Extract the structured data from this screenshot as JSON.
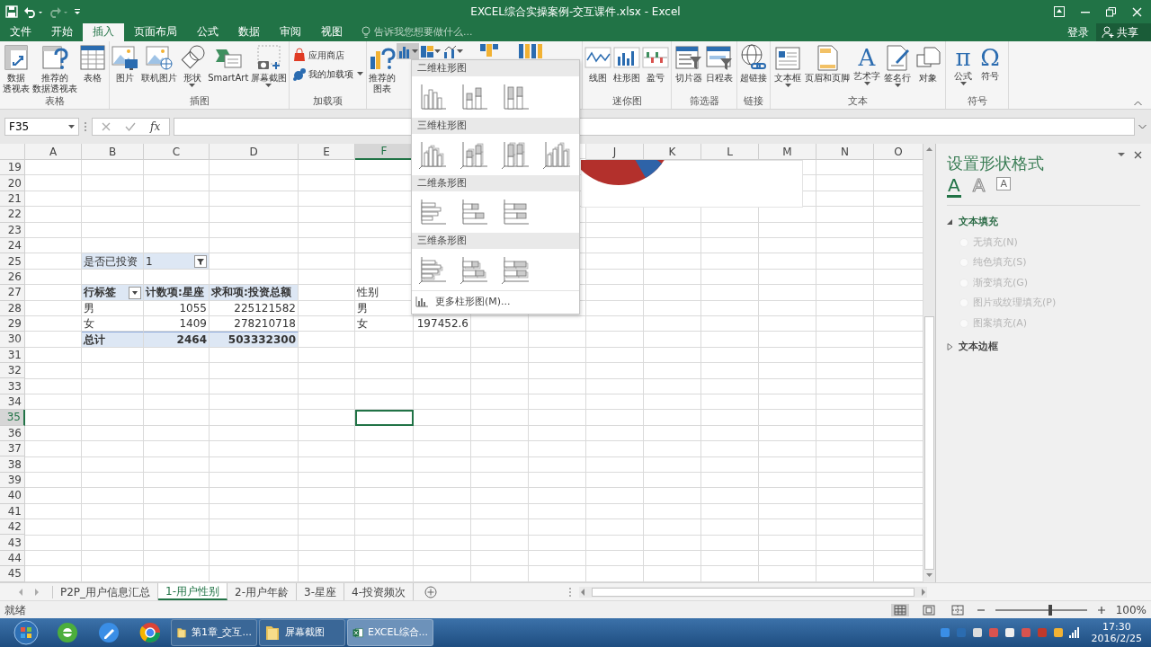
{
  "window": {
    "title": "EXCEL综合实操案例-交互课件.xlsx - Excel"
  },
  "ribbon_tabs": [
    {
      "label": "文件",
      "selected": false
    },
    {
      "label": "开始",
      "selected": false
    },
    {
      "label": "插入",
      "selected": true
    },
    {
      "label": "页面布局",
      "selected": false
    },
    {
      "label": "公式",
      "selected": false
    },
    {
      "label": "数据",
      "selected": false
    },
    {
      "label": "审阅",
      "selected": false
    },
    {
      "label": "视图",
      "selected": false
    }
  ],
  "tell_me": {
    "placeholder": "告诉我您想要做什么..."
  },
  "account": {
    "sign_in": "登录",
    "share": "共享"
  },
  "ribbon_groups": [
    {
      "label": "表格",
      "buttons": [
        {
          "kind": "large",
          "label": [
            "数据",
            "透视表"
          ]
        },
        {
          "kind": "large",
          "label": [
            "推荐的",
            "数据透视表"
          ]
        },
        {
          "kind": "large",
          "label": [
            "表格"
          ]
        }
      ]
    },
    {
      "label": "插图",
      "buttons": [
        {
          "kind": "large",
          "label": [
            "图片"
          ]
        },
        {
          "kind": "large",
          "label": [
            "联机图片"
          ]
        },
        {
          "kind": "large",
          "label": [
            "形状"
          ],
          "dropdown": true
        },
        {
          "kind": "large",
          "label": [
            "SmartArt"
          ]
        },
        {
          "kind": "large",
          "label": [
            "屏幕截图"
          ],
          "dropdown": true
        }
      ]
    },
    {
      "label": "加载项",
      "buttons": [
        {
          "kind": "small",
          "label": [
            "应用商店"
          ]
        },
        {
          "kind": "small",
          "label": [
            "我的加载项"
          ],
          "dropdown": true
        }
      ]
    },
    {
      "buttons": [
        {
          "kind": "large",
          "label": [
            "推荐的",
            "图表"
          ]
        },
        {
          "kind": "icon",
          "dropdown": true,
          "expanded": true
        },
        {
          "kind": "icon",
          "dropdown": true,
          "expanded": false
        },
        {
          "kind": "icon",
          "dropdown": true,
          "expanded": false
        },
        {
          "kind": "icon_large"
        },
        {
          "kind": "icon_large"
        }
      ]
    },
    {
      "label": "迷你图",
      "buttons": [
        {
          "kind": "large",
          "label": [
            "线图"
          ]
        },
        {
          "kind": "large",
          "label": [
            "柱形图"
          ]
        },
        {
          "kind": "large",
          "label": [
            "盈亏"
          ]
        }
      ]
    },
    {
      "label": "筛选器",
      "buttons": [
        {
          "kind": "large",
          "label": [
            "切片器"
          ]
        },
        {
          "kind": "large",
          "label": [
            "日程表"
          ]
        }
      ]
    },
    {
      "label": "链接",
      "buttons": [
        {
          "kind": "large",
          "label": [
            "超链接"
          ]
        }
      ]
    },
    {
      "label": "文本",
      "buttons": [
        {
          "kind": "large",
          "label": [
            "文本框"
          ],
          "dropdown": true
        },
        {
          "kind": "large",
          "label": [
            "页眉和页脚"
          ]
        },
        {
          "kind": "large",
          "label": [
            "艺术字"
          ],
          "dropdown": true,
          "icon_text": "A"
        },
        {
          "kind": "large",
          "label": [
            "签名行"
          ],
          "dropdown": true
        },
        {
          "kind": "large",
          "label": [
            "对象"
          ]
        }
      ]
    },
    {
      "label": "符号",
      "buttons": [
        {
          "kind": "large",
          "label": [
            "公式"
          ],
          "dropdown": true,
          "icon_text": "π"
        },
        {
          "kind": "large",
          "label": [
            "符号"
          ],
          "icon_text": "Ω"
        }
      ]
    }
  ],
  "chart_menu": {
    "sections": [
      {
        "heading": "二维柱形图",
        "kind": "column",
        "three_d": false,
        "items": [
          {
            "kind": "clustered"
          },
          {
            "kind": "stacked"
          },
          {
            "kind": "percent"
          }
        ]
      },
      {
        "heading": "三维柱形图",
        "kind": "column",
        "three_d": true,
        "items": [
          {
            "kind": "clustered"
          },
          {
            "kind": "stacked"
          },
          {
            "kind": "percent"
          },
          {
            "kind": "deep"
          }
        ]
      },
      {
        "heading": "二维条形图",
        "kind": "bar",
        "three_d": false,
        "items": [
          {
            "kind": "clustered"
          },
          {
            "kind": "stacked"
          },
          {
            "kind": "percent"
          }
        ]
      },
      {
        "heading": "三维条形图",
        "kind": "bar",
        "three_d": true,
        "items": [
          {
            "kind": "clustered"
          },
          {
            "kind": "stacked"
          },
          {
            "kind": "percent"
          }
        ]
      }
    ],
    "more": "更多柱形图(M)..."
  },
  "formula_bar": {
    "name_box": "F35",
    "fx": "fx"
  },
  "grid": {
    "columns": [
      {
        "label": "A",
        "selected": false
      },
      {
        "label": "B",
        "selected": false
      },
      {
        "label": "C",
        "selected": false
      },
      {
        "label": "D",
        "selected": false
      },
      {
        "label": "E",
        "selected": false
      },
      {
        "label": "F",
        "selected": true
      }
    ],
    "columns_right": [
      {
        "label": "J",
        "selected": false
      },
      {
        "label": "K",
        "selected": false
      },
      {
        "label": "L",
        "selected": false
      },
      {
        "label": "M",
        "selected": false
      },
      {
        "label": "N",
        "selected": false
      },
      {
        "label": "O",
        "selected": false
      }
    ],
    "rows": [
      {
        "label": "19",
        "selected": false
      },
      {
        "label": "20",
        "selected": false
      },
      {
        "label": "21",
        "selected": false
      },
      {
        "label": "22",
        "selected": false
      },
      {
        "label": "23",
        "selected": false
      },
      {
        "label": "24",
        "selected": false
      },
      {
        "label": "25",
        "selected": false,
        "cells": [
          {
            "kind": "empty"
          },
          {
            "kind": "field",
            "text": "是否已投资"
          },
          {
            "kind": "field_filter",
            "text": "1"
          }
        ]
      },
      {
        "label": "26",
        "selected": false
      },
      {
        "label": "27",
        "selected": false,
        "cells": [
          {
            "kind": "empty"
          },
          {
            "kind": "header_filter",
            "text": "行标签"
          },
          {
            "kind": "header",
            "text": "计数项:星座"
          },
          {
            "kind": "header",
            "text": "求和项:投资总额"
          },
          {
            "kind": "empty"
          },
          {
            "kind": "label",
            "text": "性别"
          }
        ]
      },
      {
        "label": "28",
        "selected": false,
        "cells": [
          {
            "kind": "empty"
          },
          {
            "kind": "label",
            "text": "男"
          },
          {
            "kind": "number",
            "text": "1055"
          },
          {
            "kind": "number",
            "text": "225121582"
          },
          {
            "kind": "empty"
          },
          {
            "kind": "label",
            "text": "男"
          }
        ]
      },
      {
        "label": "29",
        "selected": false,
        "cells": [
          {
            "kind": "empty"
          },
          {
            "kind": "label",
            "text": "女"
          },
          {
            "kind": "number",
            "text": "1409"
          },
          {
            "kind": "number",
            "text": "278210718"
          },
          {
            "kind": "empty"
          },
          {
            "kind": "label",
            "text": "女"
          },
          {
            "kind": "number",
            "text": "197452.6"
          }
        ]
      },
      {
        "label": "30",
        "selected": false,
        "cells": [
          {
            "kind": "empty"
          },
          {
            "kind": "total_label",
            "text": "总计"
          },
          {
            "kind": "total_number",
            "text": "2464"
          },
          {
            "kind": "total_number",
            "text": "503332300"
          }
        ]
      },
      {
        "label": "31",
        "selected": false
      },
      {
        "label": "32",
        "selected": false
      },
      {
        "label": "33",
        "selected": false
      },
      {
        "label": "34",
        "selected": false
      },
      {
        "label": "35",
        "selected": true
      },
      {
        "label": "36",
        "selected": false
      },
      {
        "label": "37",
        "selected": false
      },
      {
        "label": "38",
        "selected": false
      },
      {
        "label": "39",
        "selected": false
      },
      {
        "label": "40",
        "selected": false
      },
      {
        "label": "41",
        "selected": false
      },
      {
        "label": "42",
        "selected": false
      },
      {
        "label": "43",
        "selected": false
      },
      {
        "label": "44",
        "selected": false
      },
      {
        "label": "45",
        "selected": false
      }
    ]
  },
  "format_pane": {
    "title": "设置形状格式",
    "tabs": [
      {
        "icon_text": "A",
        "selected": true
      },
      {
        "icon_text": "A",
        "selected": false
      },
      {
        "icon_text": "A",
        "selected": false
      }
    ],
    "sections": [
      {
        "label": "文本填充",
        "expanded": true,
        "options": [
          {
            "label": "无填充(N)",
            "selected": false,
            "disabled": true
          },
          {
            "label": "纯色填充(S)",
            "selected": false,
            "disabled": true
          },
          {
            "label": "渐变填充(G)",
            "selected": false,
            "disabled": true
          },
          {
            "label": "图片或纹理填充(P)",
            "selected": false,
            "disabled": true
          },
          {
            "label": "图案填充(A)",
            "selected": false,
            "disabled": true
          }
        ]
      },
      {
        "label": "文本边框",
        "expanded": false
      }
    ]
  },
  "sheet_tabs": [
    {
      "label": "P2P_用户信息汇总",
      "selected": false
    },
    {
      "label": "1-用户性别",
      "selected": true
    },
    {
      "label": "2-用户年龄",
      "selected": false
    },
    {
      "label": "3-星座",
      "selected": false
    },
    {
      "label": "4-投资频次",
      "selected": false
    }
  ],
  "status_bar": {
    "text": "就绪",
    "view_buttons": [
      {
        "selected": true
      },
      {
        "selected": false
      },
      {
        "selected": false
      }
    ],
    "zoom_slider": {
      "level": 0.6
    },
    "zoom": "100%"
  },
  "taskbar": {
    "tasks": [
      {
        "kind": "folder",
        "label": "第1章_交互...",
        "selected": false
      },
      {
        "kind": "folder",
        "label": "屏幕截图",
        "selected": false
      },
      {
        "kind": "excel",
        "label": "EXCEL综合...",
        "selected": true
      }
    ],
    "time": "17:30",
    "date": "2016/2/25"
  }
}
